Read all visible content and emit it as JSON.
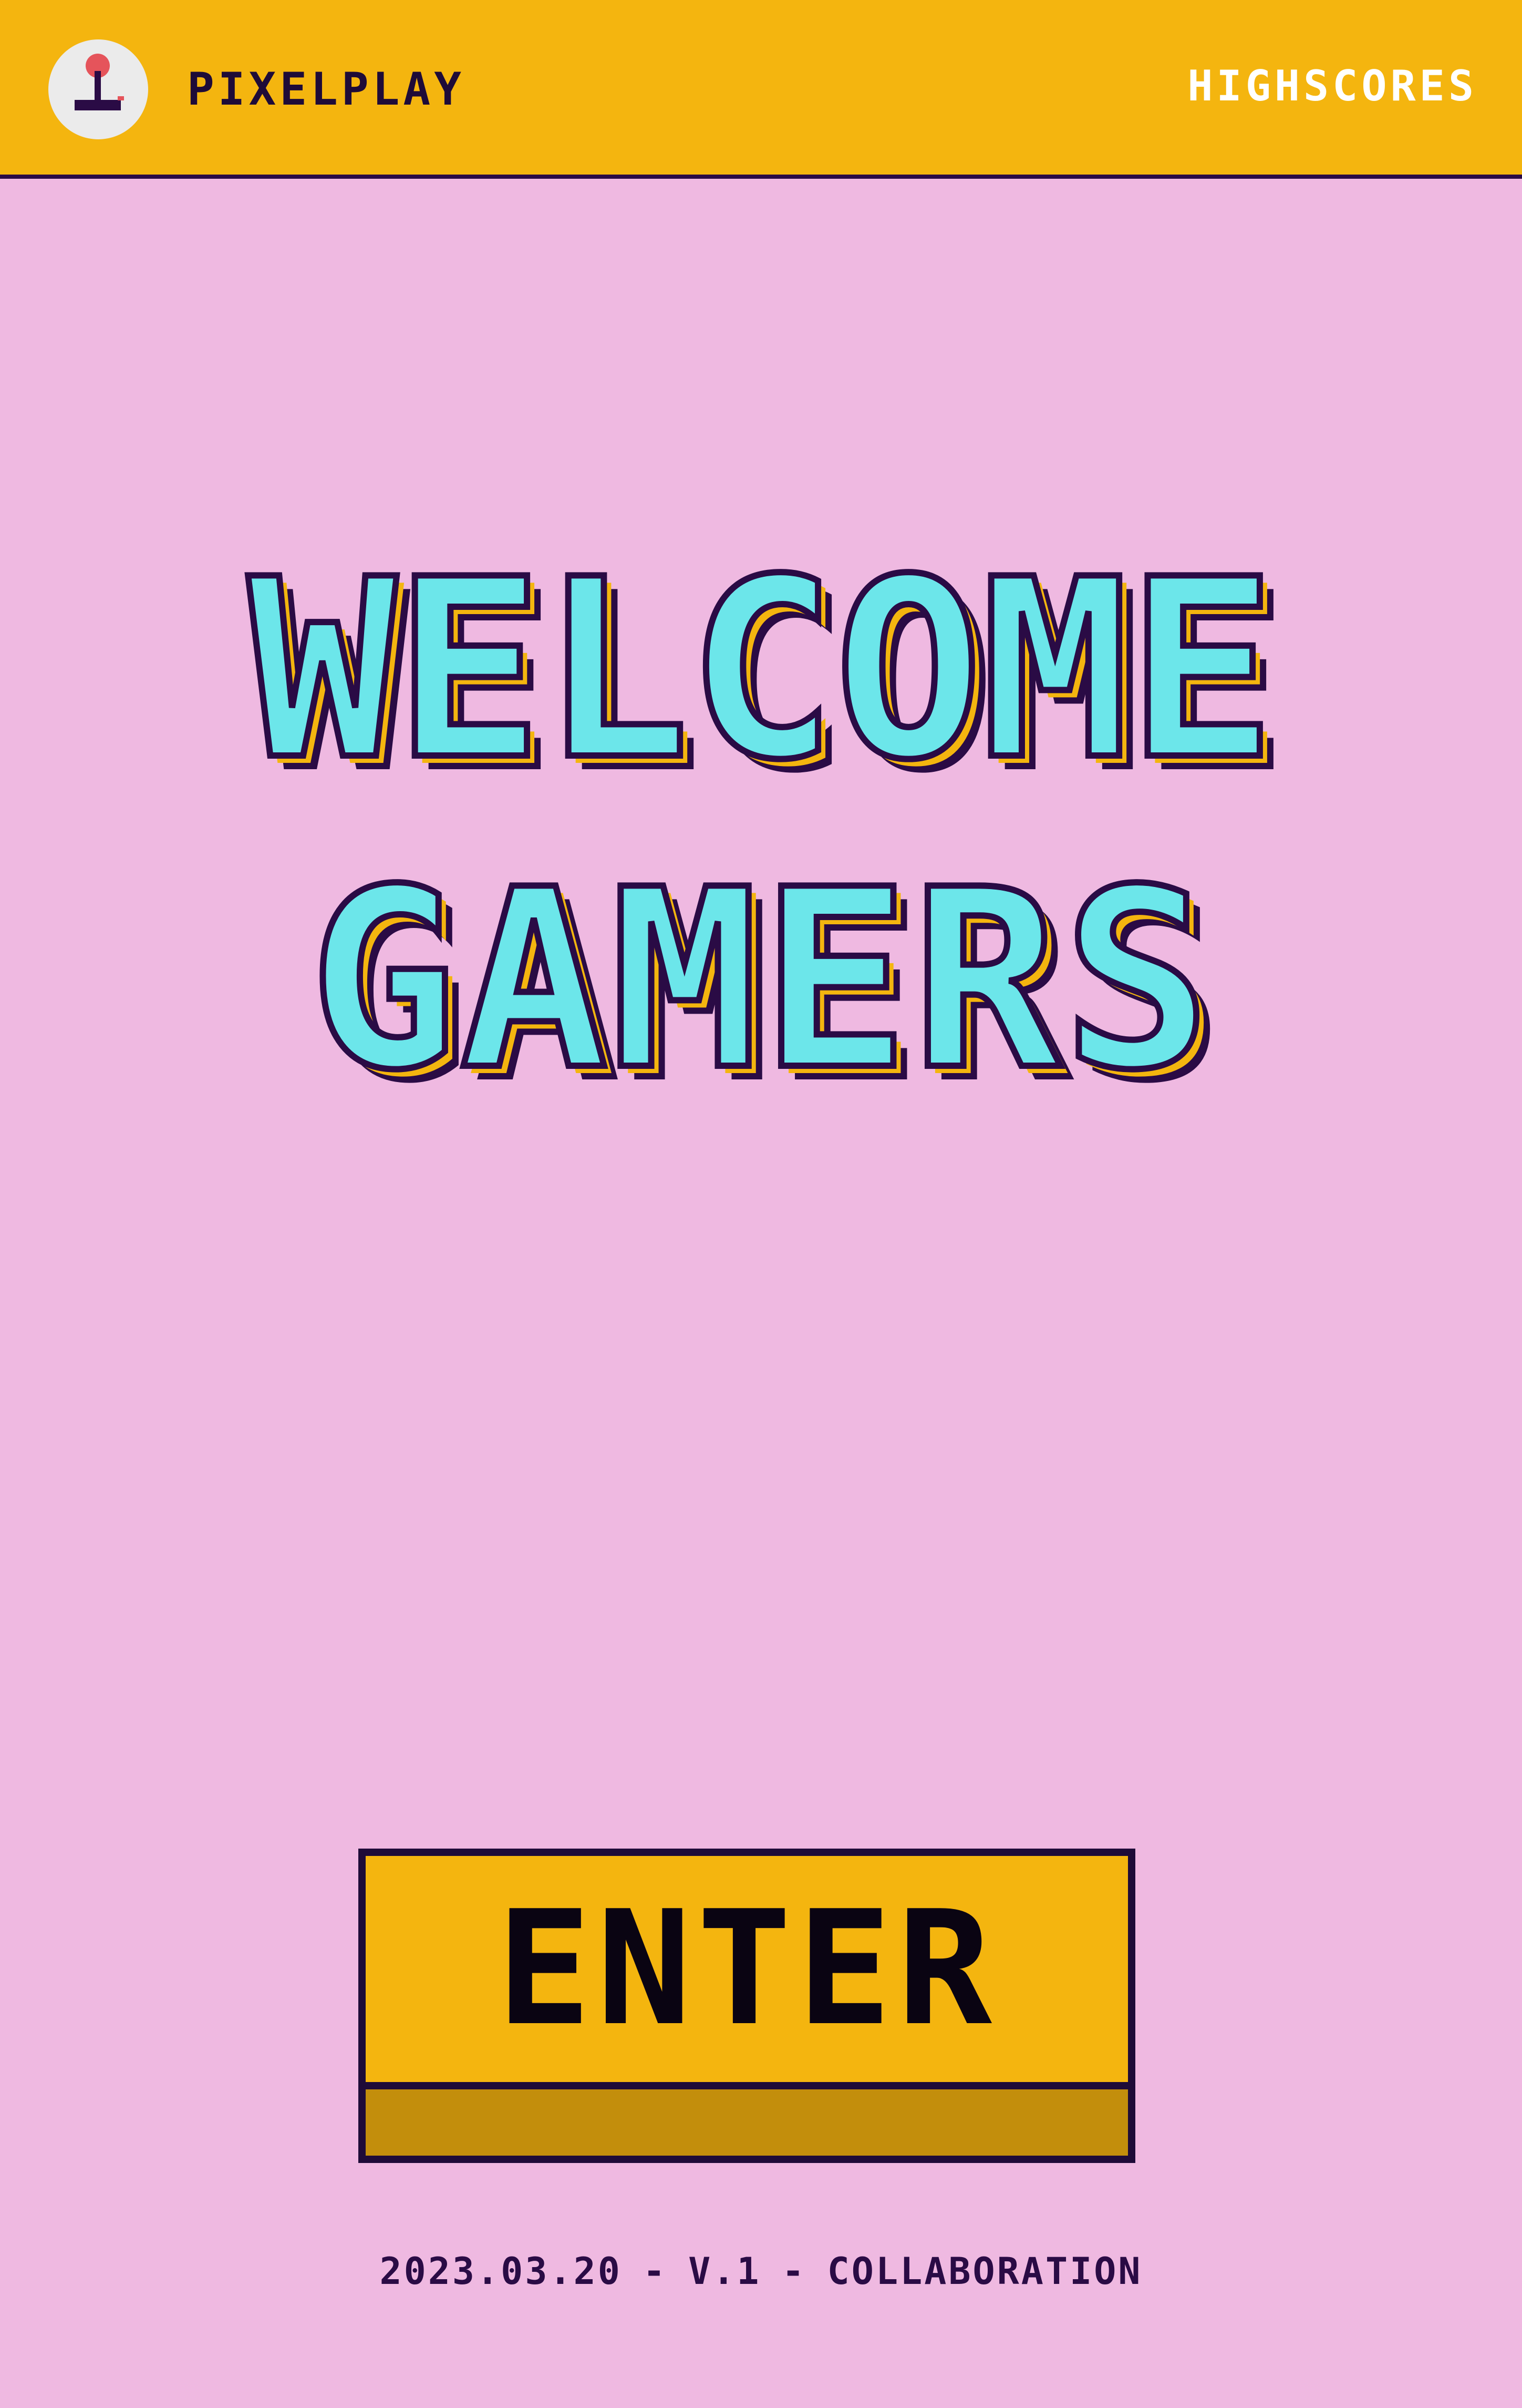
{
  "header": {
    "brand": "PIXELPLAY",
    "logo_icon": "joystick-icon",
    "nav_link": "HIGHSCORES"
  },
  "hero": {
    "line1": "WELCOME",
    "line2": "GAMERS"
  },
  "cta": {
    "label": "ENTER"
  },
  "footer": {
    "date": "2023.03.20",
    "version": "V.1",
    "note": "COLLABORATION",
    "separator": "-"
  },
  "colors": {
    "background": "#efb9e1",
    "header": "#f4b50f",
    "accent_cyan": "#6ce6ea",
    "outline": "#2a0b45",
    "button_shadow": "#c38e0c",
    "joystick_knob": "#e5545b"
  }
}
